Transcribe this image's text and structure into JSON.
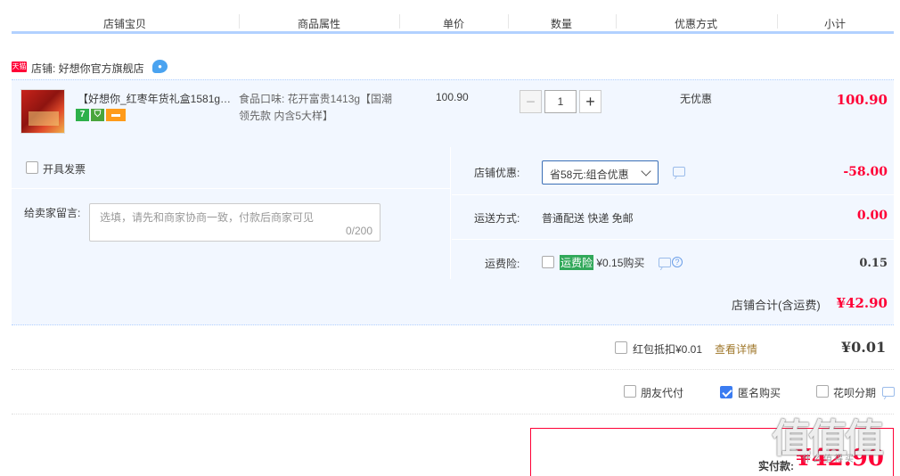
{
  "header": {
    "cols": [
      "店铺宝贝",
      "商品属性",
      "单价",
      "数量",
      "优惠方式",
      "小计"
    ]
  },
  "shop": {
    "badge": "天猫",
    "label": "店铺: 好想你官方旗舰店"
  },
  "item": {
    "name": "【好想你_红枣年货礼盒1581g…",
    "badges": [
      "7",
      "⛉",
      "▬"
    ],
    "attr": "食品口味: 花开富贵1413g【国潮领先款 内含5大样】",
    "unit_price": "100.90",
    "quantity": {
      "minus": "−",
      "value": "1",
      "plus": "+"
    },
    "discount": "无优惠",
    "subtotal": "100.90"
  },
  "options": {
    "invoice_label": "开具发票",
    "memo_label": "给卖家留言:",
    "memo_placeholder": "选填，请先和商家协商一致，付款后商家可见",
    "memo_count": "0/200",
    "shop_discount_label": "店铺优惠:",
    "shop_discount_select": "省58元:组合优惠",
    "shop_discount_value": "-58.00",
    "shipping_label": "运送方式:",
    "shipping_value": "普通配送 快递 免邮",
    "shipping_fee": "0.00",
    "insurance_label": "运费险:",
    "insurance_tag": "运费险",
    "insurance_price": "¥0.15购买",
    "insurance_fee": "0.15",
    "help_glyph": "?"
  },
  "shop_total": {
    "label": "店铺合计(含运费)",
    "value": "¥42.90"
  },
  "redpacket": {
    "label": "红包抵扣¥0.01",
    "link": "查看详情",
    "value": "¥0.01"
  },
  "pay_options": {
    "friend": "朋友代付",
    "anonymous": "匿名购买",
    "huabei": "花呗分期"
  },
  "payment": {
    "label": "实付款:",
    "value": "¥42.90"
  },
  "watermark": {
    "big": "值值值",
    "small": "什么值得买"
  },
  "colors": {
    "accent_red": "#ff0036",
    "row_bg": "#f2f7ff",
    "header_line": "#b2d1ff",
    "checkbox_blue": "#3b7cf1"
  }
}
